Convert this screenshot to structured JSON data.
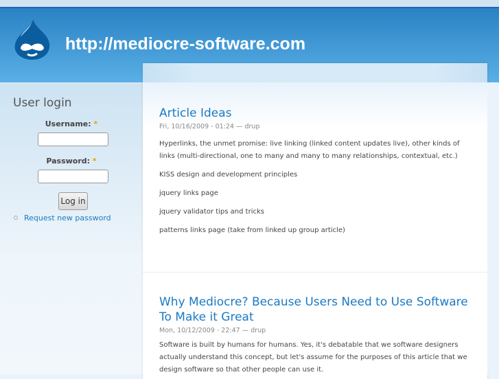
{
  "site": {
    "name": "http://mediocre-software.com",
    "logo_icon": "drupal-drop-icon"
  },
  "sidebar": {
    "title": "User login",
    "username_label": "Username:",
    "password_label": "Password:",
    "required_mark": "*",
    "username_value": "",
    "password_value": "",
    "login_label": "Log in",
    "request_password": "Request new password"
  },
  "nodes": [
    {
      "title": "Article Ideas",
      "meta": "Fri, 10/16/2009 - 01:24 — drup",
      "paragraphs": [
        "Hyperlinks, the unmet promise: live linking (linked content updates live), other kinds of links (multi-directional, one to many and many to many relationships, contextual, etc.)",
        "KISS design and development principles",
        "jquery links page",
        "jquery validator tips and tricks",
        "patterns links page (take from linked up group article)"
      ]
    },
    {
      "title": "Why Mediocre? Because Users Need to Use Software To Make it Great",
      "meta": "Mon, 10/12/2009 - 22:47 — drup",
      "paragraphs": [
        "Software is built by humans for humans. Yes, it's debatable that we software designers actually understand this concept, but let's assume for the purposes of this article that we design software so that other people can use it."
      ]
    }
  ]
}
